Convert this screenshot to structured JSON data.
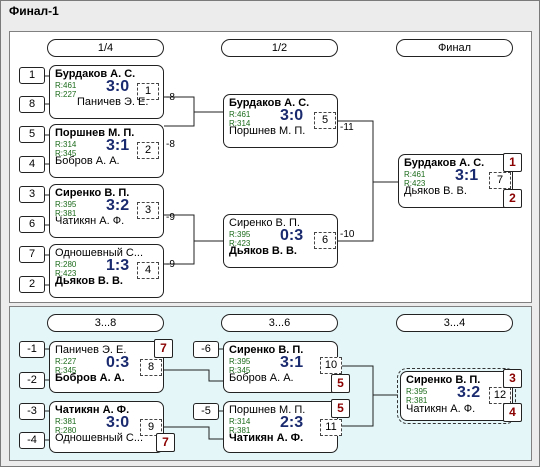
{
  "title": "Финал-1",
  "top": {
    "headers": [
      "1/4",
      "1/2",
      "Финал"
    ],
    "seeds": [
      "1",
      "8",
      "5",
      "4",
      "3",
      "6",
      "7",
      "2"
    ],
    "matches": [
      {
        "p1": "Бурдаков А. С.",
        "r1": "R:461",
        "p2": "Паничев Э. Е.",
        "r2": "R:227",
        "score": "3:0",
        "num": "1",
        "loser": "-8"
      },
      {
        "p1": "Поршнев М. П.",
        "r1": "R:314",
        "p2": "Бобров А. А.",
        "r2": "R:345",
        "score": "3:1",
        "num": "2",
        "loser": "-8"
      },
      {
        "p1": "Сиренко В. П.",
        "r1": "R:395",
        "p2": "Чатикян А. Ф.",
        "r2": "R:381",
        "score": "3:2",
        "num": "3",
        "loser": "-9"
      },
      {
        "p1": "Одношевный С...",
        "r1": "R:280",
        "p2": "Дьяков В. В.",
        "r2": "R:423",
        "score": "1:3",
        "num": "4",
        "loser": "-9"
      },
      {
        "p1": "Бурдаков А. С.",
        "r1": "R:461",
        "p2": "Поршнев М. П.",
        "r2": "R:314",
        "score": "3:0",
        "num": "5",
        "loser": "-11"
      },
      {
        "p1": "Сиренко В. П.",
        "r1": "R:395",
        "p2": "Дьяков В. В.",
        "r2": "R:423",
        "score": "0:3",
        "num": "6",
        "loser": "-10"
      },
      {
        "p1": "Бурдаков А. С.",
        "r1": "R:461",
        "p2": "Дьяков В. В.",
        "r2": "R:423",
        "score": "3:1",
        "num": "7",
        "place1": "1",
        "place2": "2"
      }
    ]
  },
  "bottom": {
    "headers": [
      "3...8",
      "3...6",
      "3...4"
    ],
    "seeds": [
      "-1",
      "-2",
      "-3",
      "-4",
      "-6",
      "-5"
    ],
    "matches": [
      {
        "p1": "Паничев Э. Е.",
        "r1": "R:227",
        "p2": "Бобров А. А.",
        "r2": "R:345",
        "score": "0:3",
        "num": "8",
        "place": "7"
      },
      {
        "p1": "Чатикян А. Ф.",
        "r1": "R:381",
        "p2": "Одношевный С...",
        "r2": "R:280",
        "score": "3:0",
        "num": "9",
        "place": "7"
      },
      {
        "p1": "Сиренко В. П.",
        "r1": "R:395",
        "p2": "Бобров А. А.",
        "r2": "R:345",
        "score": "3:1",
        "num": "10",
        "place": "5"
      },
      {
        "p1": "Поршнев М. П.",
        "r1": "R:314",
        "p2": "Чатикян А. Ф.",
        "r2": "R:381",
        "score": "2:3",
        "num": "11",
        "place": "5"
      },
      {
        "p1": "Сиренко В. П.",
        "r1": "R:395",
        "p2": "Чатикян А. Ф.",
        "r2": "R:381",
        "score": "3:2",
        "num": "12",
        "place1": "3",
        "place2": "4"
      }
    ]
  }
}
